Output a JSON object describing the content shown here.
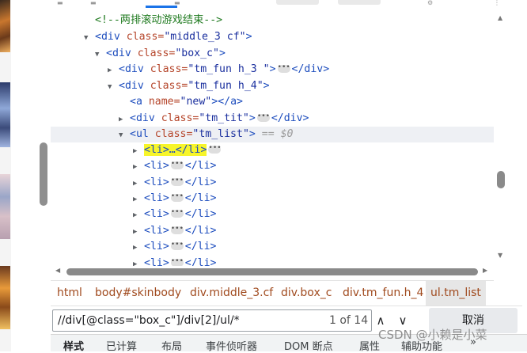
{
  "dom_tree": {
    "comment": "<!--两排滚动游戏结束-->",
    "rows": {
      "r1": {
        "tag": "<div",
        "attr": "class=",
        "val": "\"middle_3 cf\"",
        "close": ">"
      },
      "r2": {
        "tag": "<div",
        "attr": "class=",
        "val": "\"box_c\"",
        "close": ">"
      },
      "r3": {
        "tag": "<div",
        "attr": "class=",
        "val": "\"tm_fun h_3 \"",
        "close": ">",
        "end": "</div>"
      },
      "r4": {
        "tag": "<div",
        "attr": "class=",
        "val": "\"tm_fun h_4\"",
        "close": ">"
      },
      "r5": {
        "tag": "<a",
        "attr": "name=",
        "val": "\"new\"",
        "close": "></a>"
      },
      "r6": {
        "tag": "<div",
        "attr": "class=",
        "val": "\"tm_tit\"",
        "close": ">",
        "end": "</div>"
      },
      "r7": {
        "tag": "<ul",
        "attr": "class=",
        "val": "\"tm_list\"",
        "close": ">",
        "eq": "== $0"
      }
    },
    "li_open": "<li>",
    "li_close": "</li>",
    "li_first": "<li>…</li>",
    "ellipsis": "•••",
    "more": "•••"
  },
  "breadcrumb": {
    "c1": "html",
    "c2": "body#skinbody",
    "c3": "div.middle_3.cf",
    "c4": "div.box_c",
    "c5": "div.tm_fun.h_4",
    "c6": "ul.tm_list"
  },
  "search": {
    "value": "//div[@class=\"box_c\"]/div[2]/ul/*",
    "match_count": "1 of 14",
    "prev_icon": "chevron-up",
    "next_icon": "chevron-down",
    "cancel_label": "取消"
  },
  "bottom_tabs": {
    "t1": "样式",
    "t2": "已计算",
    "t3": "布局",
    "t4": "事件侦听器",
    "t5": "DOM 断点",
    "t6": "属性",
    "t7": "辅助功能"
  },
  "watermark": "CSDN @小赖是小菜"
}
